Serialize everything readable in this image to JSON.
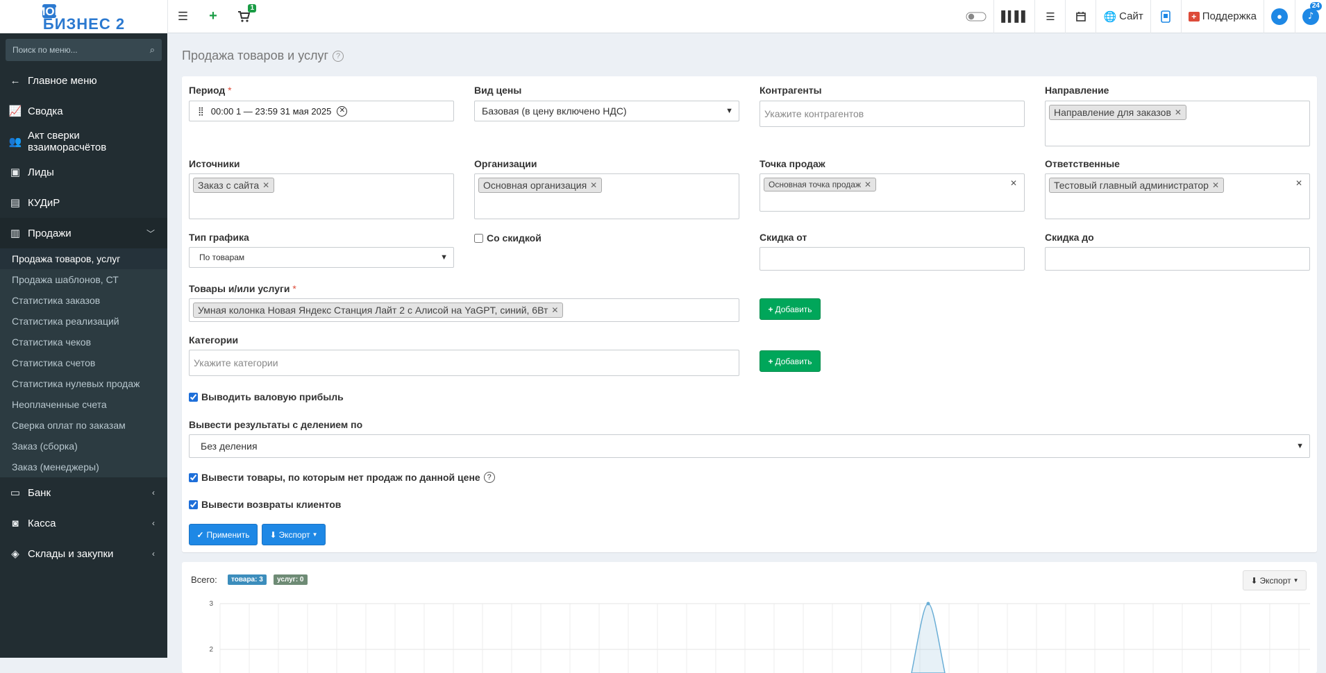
{
  "header": {
    "logo_line1": "МОЙ",
    "logo_line2": "БИЗНЕС 2",
    "cart_badge": "1",
    "site_label": "Сайт",
    "support_label": "Поддержка",
    "notifications_badge": "24"
  },
  "sidebar": {
    "search_placeholder": "Поиск по меню...",
    "items": [
      {
        "label": "Главное меню",
        "icon": "arrow-left-icon"
      },
      {
        "label": "Сводка",
        "icon": "line-chart-icon"
      },
      {
        "label": "Акт сверки взаиморасчётов",
        "icon": "users-icon"
      },
      {
        "label": "Лиды",
        "icon": "contact-card-icon"
      },
      {
        "label": "КУДиР",
        "icon": "book-icon"
      },
      {
        "label": "Продажи",
        "icon": "bar-chart-icon"
      }
    ],
    "sales_submenu": [
      "Продажа товаров, услуг",
      "Продажа шаблонов, СТ",
      "Статистика заказов",
      "Статистика реализаций",
      "Статистика чеков",
      "Статистика счетов",
      "Статистика нулевых продаж",
      "Неоплаченные счета",
      "Сверка оплат по заказам",
      "Заказ (сборка)",
      "Заказ (менеджеры)"
    ],
    "bottom_items": [
      {
        "label": "Банк",
        "icon": "credit-card-icon"
      },
      {
        "label": "Касса",
        "icon": "cash-icon"
      },
      {
        "label": "Склады и закупки",
        "icon": "box-icon"
      }
    ]
  },
  "page": {
    "title": "Продажа товаров и услуг"
  },
  "filters": {
    "period_label": "Период",
    "period_value": "00:00 1 — 23:59 31 мая 2025",
    "price_type_label": "Вид цены",
    "price_type_value": "Базовая (в цену включено НДС)",
    "counterparties_label": "Контрагенты",
    "counterparties_placeholder": "Укажите контрагентов",
    "direction_label": "Направление",
    "direction_tag": "Направление для заказов",
    "sources_label": "Источники",
    "sources_tag": "Заказ с сайта",
    "orgs_label": "Организации",
    "orgs_tag": "Основная организация",
    "point_label": "Точка продаж",
    "point_tag": "Основная точка продаж",
    "responsible_label": "Ответственные",
    "responsible_tag": "Тестовый главный администратор",
    "chart_type_label": "Тип графика",
    "chart_type_value": "По товарам",
    "discount_check_label": "Со скидкой",
    "discount_from_label": "Скидка от",
    "discount_to_label": "Скидка до",
    "goods_label": "Товары и/или услуги",
    "goods_tag": "Умная колонка Новая Яндекс Станция Лайт 2 с Алисой на YaGPT, синий, 6Вт",
    "add_label": "Добавить",
    "categories_label": "Категории",
    "categories_placeholder": "Укажите категории",
    "gross_profit_label": "Выводить валовую прибыль",
    "split_label": "Вывести результаты с делением по",
    "split_value": "Без деления",
    "no_sales_label": "Вывести товары, по которым нет продаж по данной цене",
    "returns_label": "Вывести возвраты клиентов",
    "apply_label": "Применить",
    "export_label": "Экспорт"
  },
  "summary": {
    "total_label": "Всего:",
    "goods_badge": "товара: 3",
    "services_badge": "услуг: 0",
    "export_label": "Экспорт"
  },
  "chart_data": {
    "type": "area",
    "y_ticks": [
      "3",
      "2"
    ],
    "ylim": [
      2,
      3
    ],
    "peak_value": 3
  }
}
